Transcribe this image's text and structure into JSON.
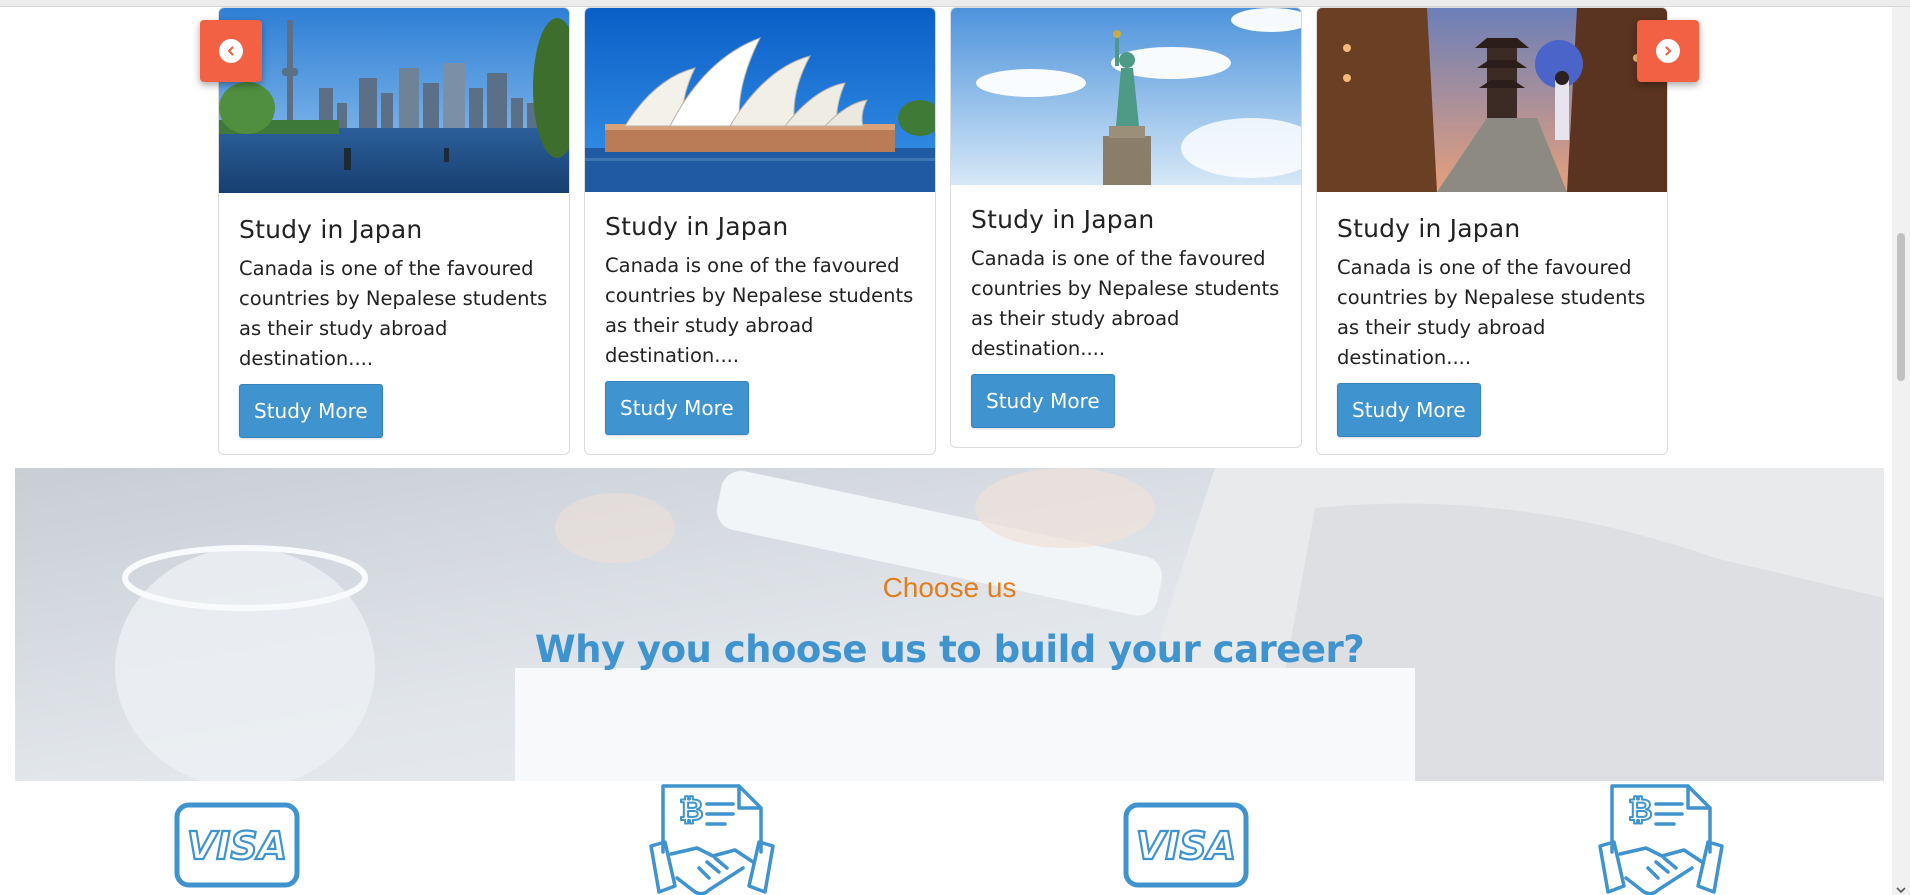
{
  "cards": [
    {
      "title": "Study in Japan",
      "text": "Canada is one of the favoured countries by Nepalese students as their study abroad destination....",
      "button": "Study More",
      "image": "toronto-skyline-image"
    },
    {
      "title": "Study in Japan",
      "text": "Canada is one of the favoured countries by Nepalese students as their study abroad destination....",
      "button": "Study More",
      "image": "sydney-opera-house-image"
    },
    {
      "title": "Study in Japan",
      "text": "Canada is one of the favoured countries by Nepalese students as their study abroad destination....",
      "button": "Study More",
      "image": "statue-of-liberty-image"
    },
    {
      "title": "Study in Japan",
      "text": "Canada is one of the favoured countries by Nepalese students as their study abroad destination....",
      "button": "Study More",
      "image": "kyoto-street-image"
    }
  ],
  "carousel": {
    "prev_icon": "chevron-left-icon",
    "next_icon": "chevron-right-icon"
  },
  "choose": {
    "subtitle": "Choose us",
    "title": "Why you choose us to build your career?"
  },
  "features": [
    {
      "icon": "visa-card-icon",
      "label": "VISA"
    },
    {
      "icon": "bitcoin-contract-handshake-icon"
    },
    {
      "icon": "visa-card-icon",
      "label": "VISA"
    },
    {
      "icon": "bitcoin-contract-handshake-icon"
    }
  ],
  "colors": {
    "accent": "#3f93cf",
    "arrow": "#f26143",
    "subtitle": "#e27d1d"
  }
}
